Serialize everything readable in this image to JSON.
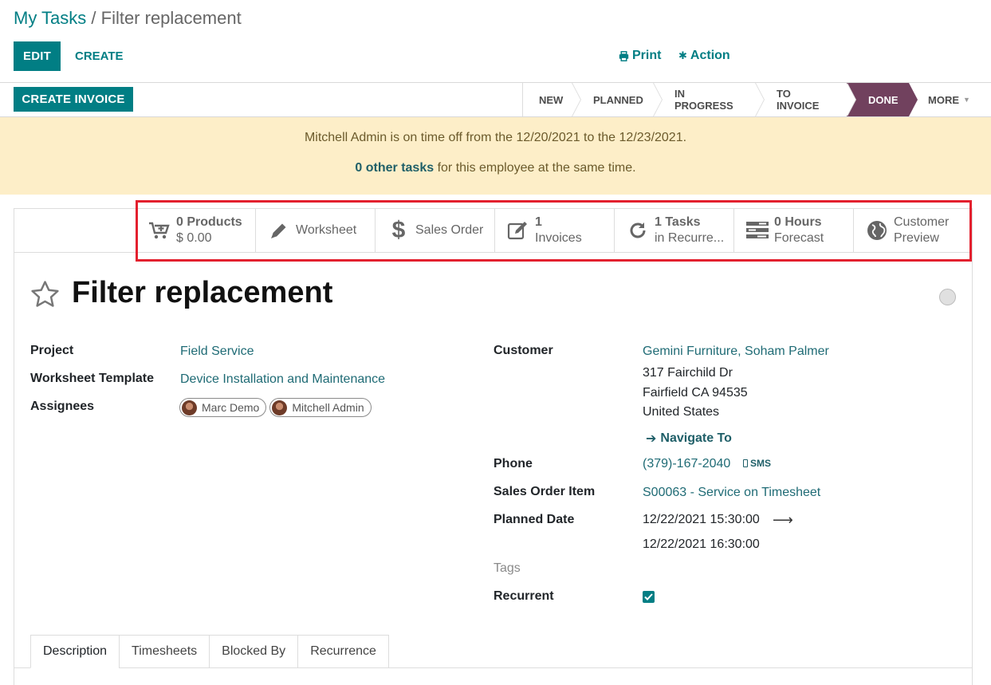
{
  "breadcrumb": {
    "parent": "My Tasks",
    "separator": " / ",
    "current": "Filter replacement"
  },
  "control": {
    "edit": "EDIT",
    "create": "CREATE",
    "print": "Print",
    "action": "Action"
  },
  "header": {
    "create_invoice": "CREATE INVOICE",
    "stages": [
      {
        "label": "NEW"
      },
      {
        "label": "PLANNED"
      },
      {
        "label": "IN PROGRESS"
      },
      {
        "label": "TO INVOICE"
      },
      {
        "label": "DONE",
        "active": true
      },
      {
        "label": "MORE"
      }
    ]
  },
  "alert": {
    "line1": "Mitchell Admin is on time off from the 12/20/2021 to the 12/23/2021.",
    "link": "0 other tasks",
    "line2_rest": " for this employee at the same time."
  },
  "smart_buttons": {
    "products_value": "0 Products",
    "products_sub": "$ 0.00",
    "worksheet": "Worksheet",
    "sales_order": "Sales Order",
    "invoices_value": "1",
    "invoices_sub": "Invoices",
    "tasks_value": "1 Tasks",
    "tasks_sub": "in Recurre...",
    "hours_value": "0  Hours",
    "hours_sub": "Forecast",
    "preview_line1": "Customer",
    "preview_line2": "Preview"
  },
  "task": {
    "title": "Filter replacement"
  },
  "fields": {
    "project_label": "Project",
    "project_value": "Field Service",
    "worksheet_label": "Worksheet Template",
    "worksheet_value": "Device Installation and Maintenance",
    "assignees_label": "Assignees",
    "assignees": [
      "Marc Demo",
      "Mitchell Admin"
    ],
    "customer_label": "Customer",
    "customer_name": "Gemini Furniture, Soham Palmer",
    "address1": "317 Fairchild Dr",
    "address2": "Fairfield CA 94535",
    "address3": "United States",
    "navigate": "Navigate To",
    "phone_label": "Phone",
    "phone_value": "(379)-167-2040",
    "sms": "SMS",
    "soi_label": "Sales Order Item",
    "soi_value": "S00063 - Service on Timesheet",
    "planned_label": "Planned Date",
    "planned_start": "12/22/2021 15:30:00",
    "planned_end": "12/22/2021 16:30:00",
    "tags_label": "Tags",
    "recurrent_label": "Recurrent"
  },
  "tabs": [
    {
      "label": "Description",
      "active": true
    },
    {
      "label": "Timesheets"
    },
    {
      "label": "Blocked By"
    },
    {
      "label": "Recurrence"
    }
  ],
  "colors": {
    "primary": "#017e84",
    "done_stage": "#71415e",
    "alert_bg": "#fdeec8",
    "highlight": "#e3202e"
  }
}
